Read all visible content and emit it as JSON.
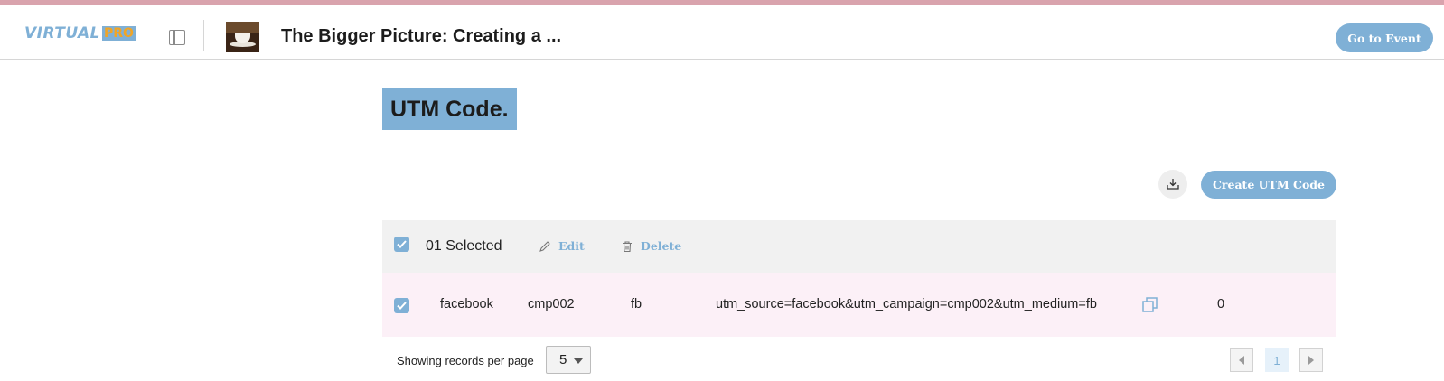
{
  "header": {
    "logo_virtual": "VIRTUAL",
    "logo_pro": "PRO",
    "event_title": "The Bigger Picture: Creating a ...",
    "go_to_event_label": "Go to Event"
  },
  "page": {
    "title": "UTM Code.",
    "create_label": "Create UTM Code"
  },
  "selection_bar": {
    "selected_text": "01 Selected",
    "edit_label": "Edit",
    "delete_label": "Delete"
  },
  "rows": [
    {
      "checked": true,
      "source": "facebook",
      "campaign": "cmp002",
      "medium": "fb",
      "query": "utm_source=facebook&utm_campaign=cmp002&utm_medium=fb",
      "count": "0"
    }
  ],
  "footer": {
    "per_page_label": "Showing records per page",
    "per_page_value": "5",
    "current_page": "1"
  },
  "colors": {
    "accent": "#7fb0d6",
    "row_highlight": "#fcf0f7",
    "selection_bar": "#f1f1f1"
  }
}
